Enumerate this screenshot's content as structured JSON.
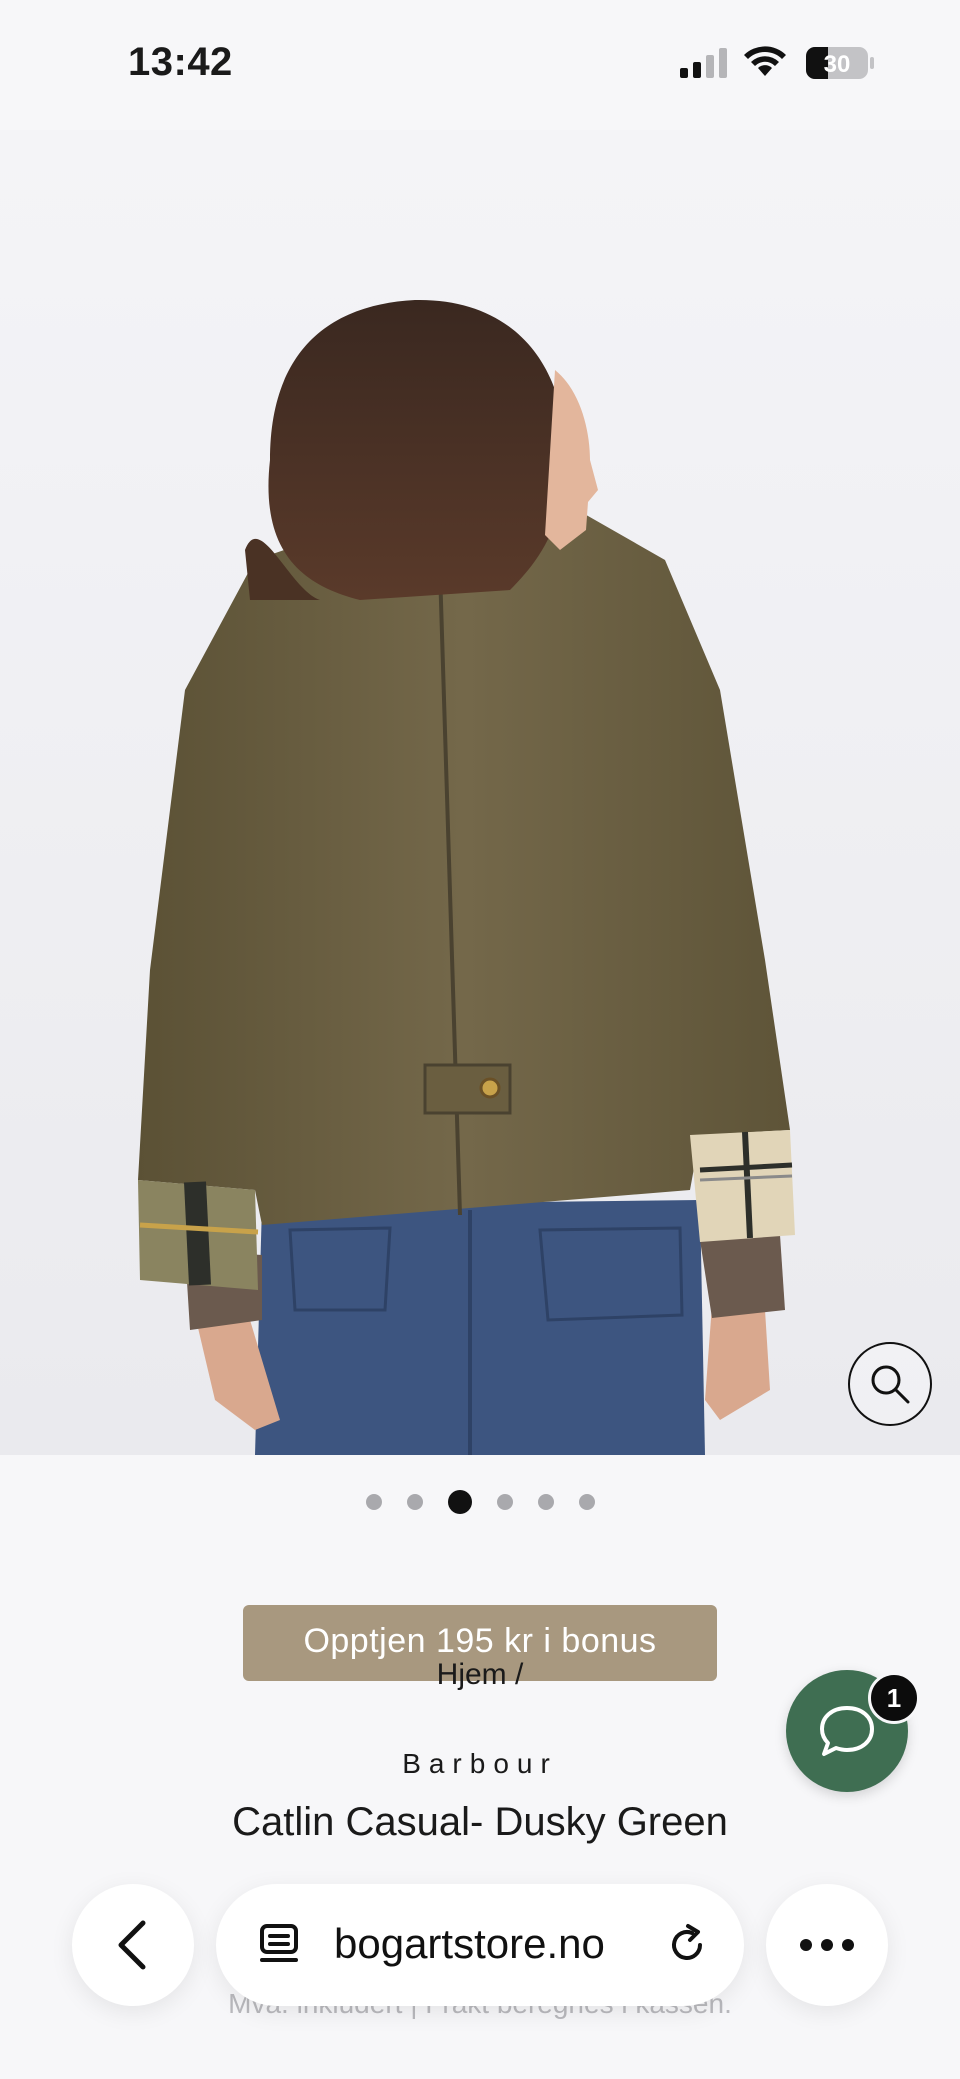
{
  "status_bar": {
    "time": "13:42",
    "battery": "30"
  },
  "gallery": {
    "slide_count": 6,
    "active_index": 2
  },
  "product": {
    "bonus_text": "Opptjen 195 kr i bonus",
    "breadcrumb": "Hjem /",
    "brand": "Barbour",
    "title": "Catlin Casual- Dusky Green",
    "tax_note": "Mva. inkludert | Frakt beregnes i kassen."
  },
  "chat": {
    "badge_count": "1"
  },
  "browser": {
    "url": "bogartstore.no"
  },
  "colors": {
    "bonus_bar": "#a8987f",
    "chat_button": "#3f6e52",
    "jacket": "#6b5f3f",
    "jeans": "#3d5580"
  }
}
